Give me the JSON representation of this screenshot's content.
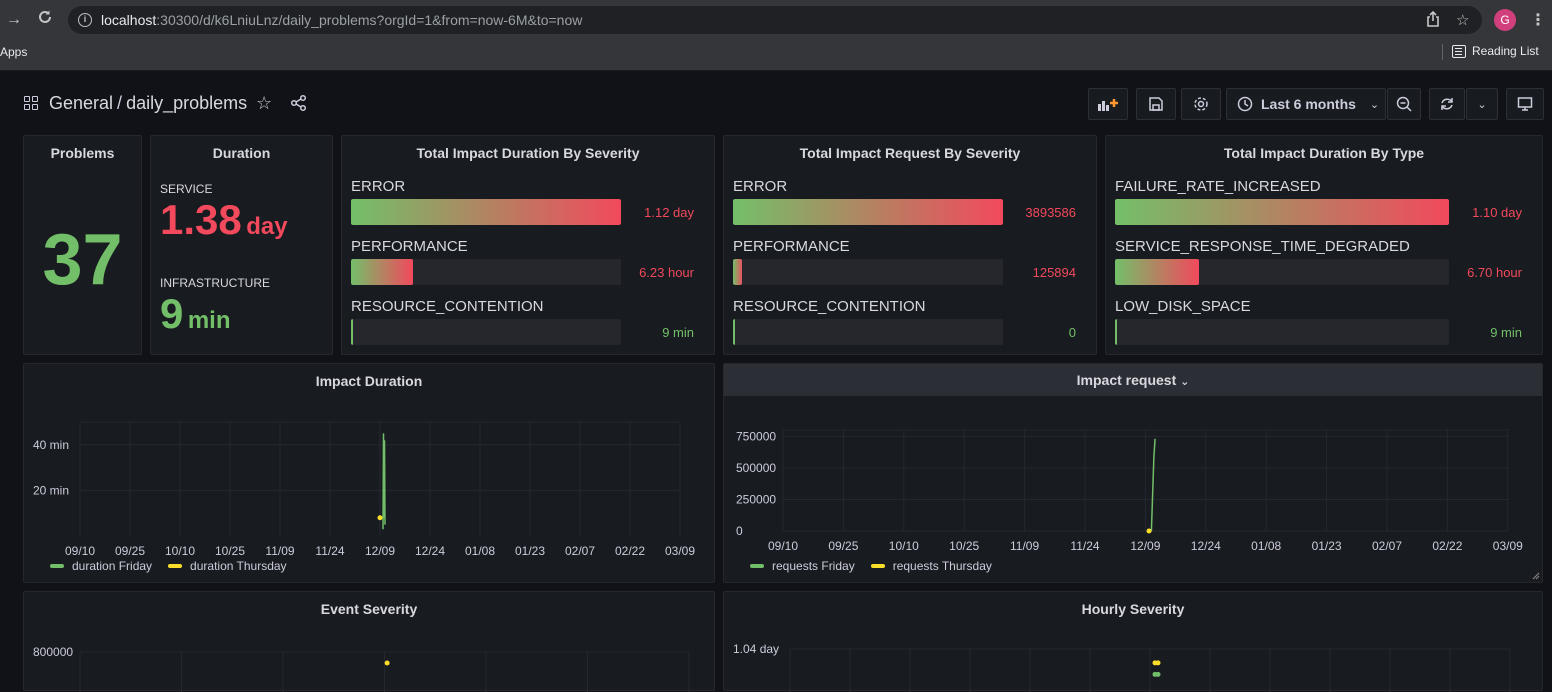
{
  "browser": {
    "url_host": "localhost",
    "url_rest": ":30300/d/k6LniuLnz/daily_problems?orgId=1&from=now-6M&to=now",
    "avatar_letter": "G",
    "bookmark_apps": "Apps",
    "bookmark_reading_list": "Reading List"
  },
  "header": {
    "folder": "General",
    "separator": "/",
    "dashboard": "daily_problems",
    "time_range": "Last 6 months"
  },
  "colors": {
    "green": "#73bf69",
    "red": "#f2495c",
    "yellow": "#fade2a",
    "panel_bg": "#181b1f"
  },
  "stats": {
    "problems": {
      "title": "Problems",
      "value": "37"
    },
    "duration": {
      "title": "Duration",
      "service_label": "SERVICE",
      "service_value": "1.38",
      "service_unit": "day",
      "infra_label": "INFRASTRUCTURE",
      "infra_value": "9",
      "infra_unit": "min"
    }
  },
  "bargauges": [
    {
      "title": "Total Impact Duration By Severity",
      "rows": [
        {
          "name": "ERROR",
          "value": "1.12 day",
          "fraction": 1.0,
          "color": "red"
        },
        {
          "name": "PERFORMANCE",
          "value": "6.23 hour",
          "fraction": 0.23,
          "color": "red"
        },
        {
          "name": "RESOURCE_CONTENTION",
          "value": "9 min",
          "fraction": 0.006,
          "color": "green"
        }
      ]
    },
    {
      "title": "Total Impact Request By Severity",
      "rows": [
        {
          "name": "ERROR",
          "value": "3893586",
          "fraction": 1.0,
          "color": "red"
        },
        {
          "name": "PERFORMANCE",
          "value": "125894",
          "fraction": 0.032,
          "color": "red"
        },
        {
          "name": "RESOURCE_CONTENTION",
          "value": "0",
          "fraction": 0.0,
          "color": "green"
        }
      ]
    },
    {
      "title": "Total Impact Duration By Type",
      "rows": [
        {
          "name": "FAILURE_RATE_INCREASED",
          "value": "1.10 day",
          "fraction": 1.0,
          "color": "red"
        },
        {
          "name": "SERVICE_RESPONSE_TIME_DEGRADED",
          "value": "6.70 hour",
          "fraction": 0.25,
          "color": "red"
        },
        {
          "name": "LOW_DISK_SPACE",
          "value": "9 min",
          "fraction": 0.006,
          "color": "green"
        }
      ]
    }
  ],
  "chart_data": [
    {
      "type": "line",
      "title": "Impact Duration",
      "x_ticks": [
        "09/10",
        "09/25",
        "10/10",
        "10/25",
        "11/09",
        "11/24",
        "12/09",
        "12/24",
        "01/08",
        "01/23",
        "02/07",
        "02/22",
        "03/09"
      ],
      "y_ticks": [
        "20 min",
        "40 min"
      ],
      "ylim": [
        0,
        50
      ],
      "series": [
        {
          "name": "duration Friday",
          "color": "#73bf69",
          "points": [
            [
              6.06,
              3
            ],
            [
              6.07,
              45
            ],
            [
              6.08,
              8
            ],
            [
              6.09,
              42
            ],
            [
              6.1,
              5
            ]
          ]
        },
        {
          "name": "duration Thursday",
          "color": "#fade2a",
          "points": [
            [
              6.0,
              8
            ]
          ]
        }
      ]
    },
    {
      "type": "line",
      "title": "Impact request",
      "x_ticks": [
        "09/10",
        "09/25",
        "10/10",
        "10/25",
        "11/09",
        "11/24",
        "12/09",
        "12/24",
        "01/08",
        "01/23",
        "02/07",
        "02/22",
        "03/09"
      ],
      "y_ticks": [
        "0",
        "250000",
        "500000",
        "750000"
      ],
      "ylim": [
        0,
        800000
      ],
      "series": [
        {
          "name": "requests Friday",
          "color": "#73bf69",
          "points": [
            [
              6.1,
              0
            ],
            [
              6.14,
              590000
            ],
            [
              6.16,
              730000
            ]
          ]
        },
        {
          "name": "requests Thursday",
          "color": "#fade2a",
          "points": [
            [
              6.06,
              0
            ]
          ]
        }
      ]
    },
    {
      "type": "scatter",
      "title": "Event Severity",
      "y_ticks": [
        "800000"
      ],
      "series": [
        {
          "name": "",
          "color": "#fade2a",
          "points": [
            [
              6.09,
              760000
            ]
          ]
        }
      ]
    },
    {
      "type": "scatter",
      "title": "Hourly Severity",
      "y_ticks": [
        "1.04 day"
      ],
      "series": [
        {
          "name": "",
          "color": "#fade2a",
          "points": [
            [
              6.1,
              0.98
            ],
            [
              6.15,
              0.98
            ]
          ]
        },
        {
          "name": "",
          "color": "#73bf69",
          "points": [
            [
              6.1,
              0.93
            ],
            [
              6.15,
              0.93
            ]
          ]
        }
      ]
    }
  ]
}
